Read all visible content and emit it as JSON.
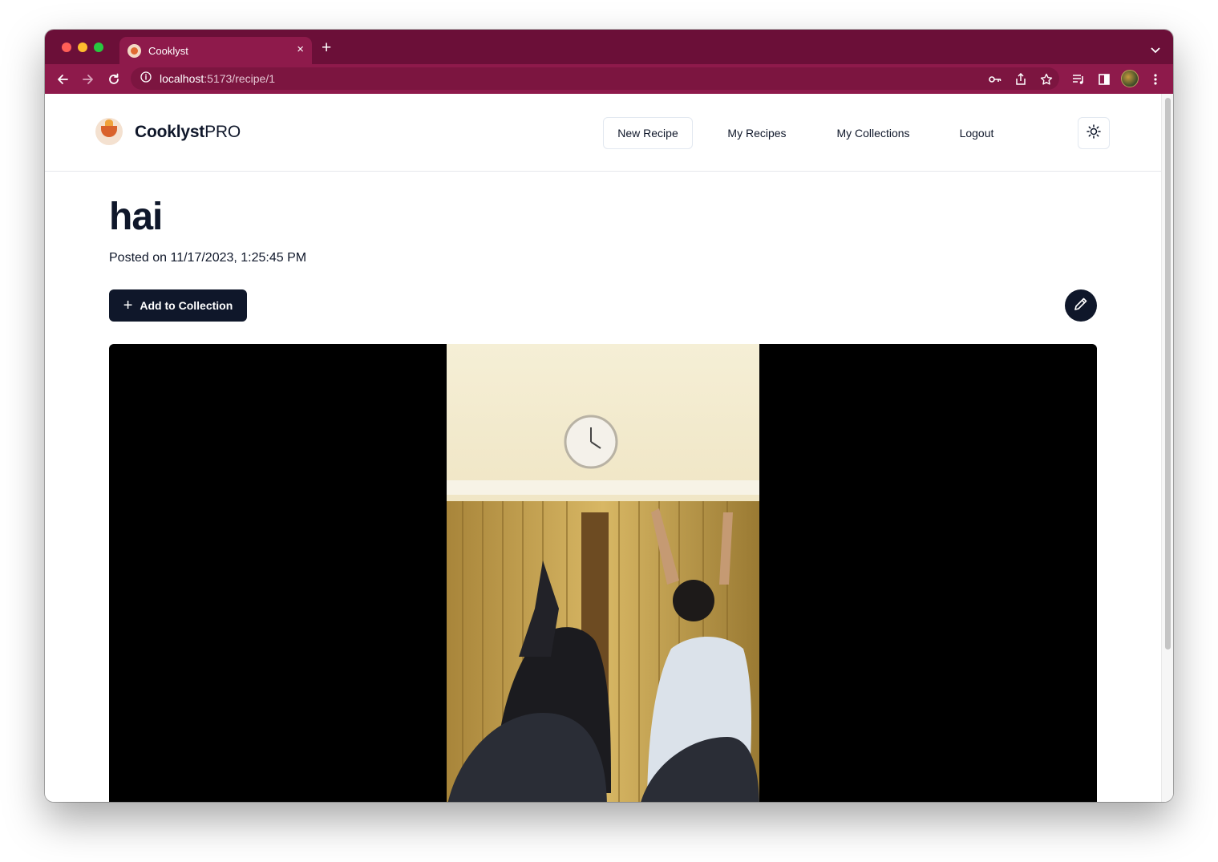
{
  "browser": {
    "tab_title": "Cooklyst",
    "tab_close": "×",
    "new_tab": "+",
    "url_host": "localhost",
    "url_path": ":5173/recipe/1"
  },
  "site": {
    "brand_bold": "Cooklyst",
    "brand_light": "PRO",
    "nav": {
      "new_recipe": "New Recipe",
      "my_recipes": "My Recipes",
      "my_collections": "My Collections",
      "logout": "Logout"
    }
  },
  "recipe": {
    "title": "hai",
    "posted": "Posted on 11/17/2023, 1:25:45 PM",
    "add_to_collection": "Add to Collection",
    "add_icon": "+"
  },
  "icons": {
    "back": "arrow-left-icon",
    "forward": "arrow-right-icon",
    "reload": "reload-icon",
    "site_info": "info-icon",
    "password": "key-icon",
    "share": "share-icon",
    "bookmark": "star-icon",
    "reading_list": "playlist-icon",
    "side_panel": "side-panel-icon",
    "menu": "kebab-menu-icon",
    "theme": "sun-icon",
    "edit": "pencil-icon"
  },
  "colors": {
    "browser_frame": "#6b0f38",
    "browser_toolbar": "#8e1a4b",
    "primary": "#0f172a"
  }
}
